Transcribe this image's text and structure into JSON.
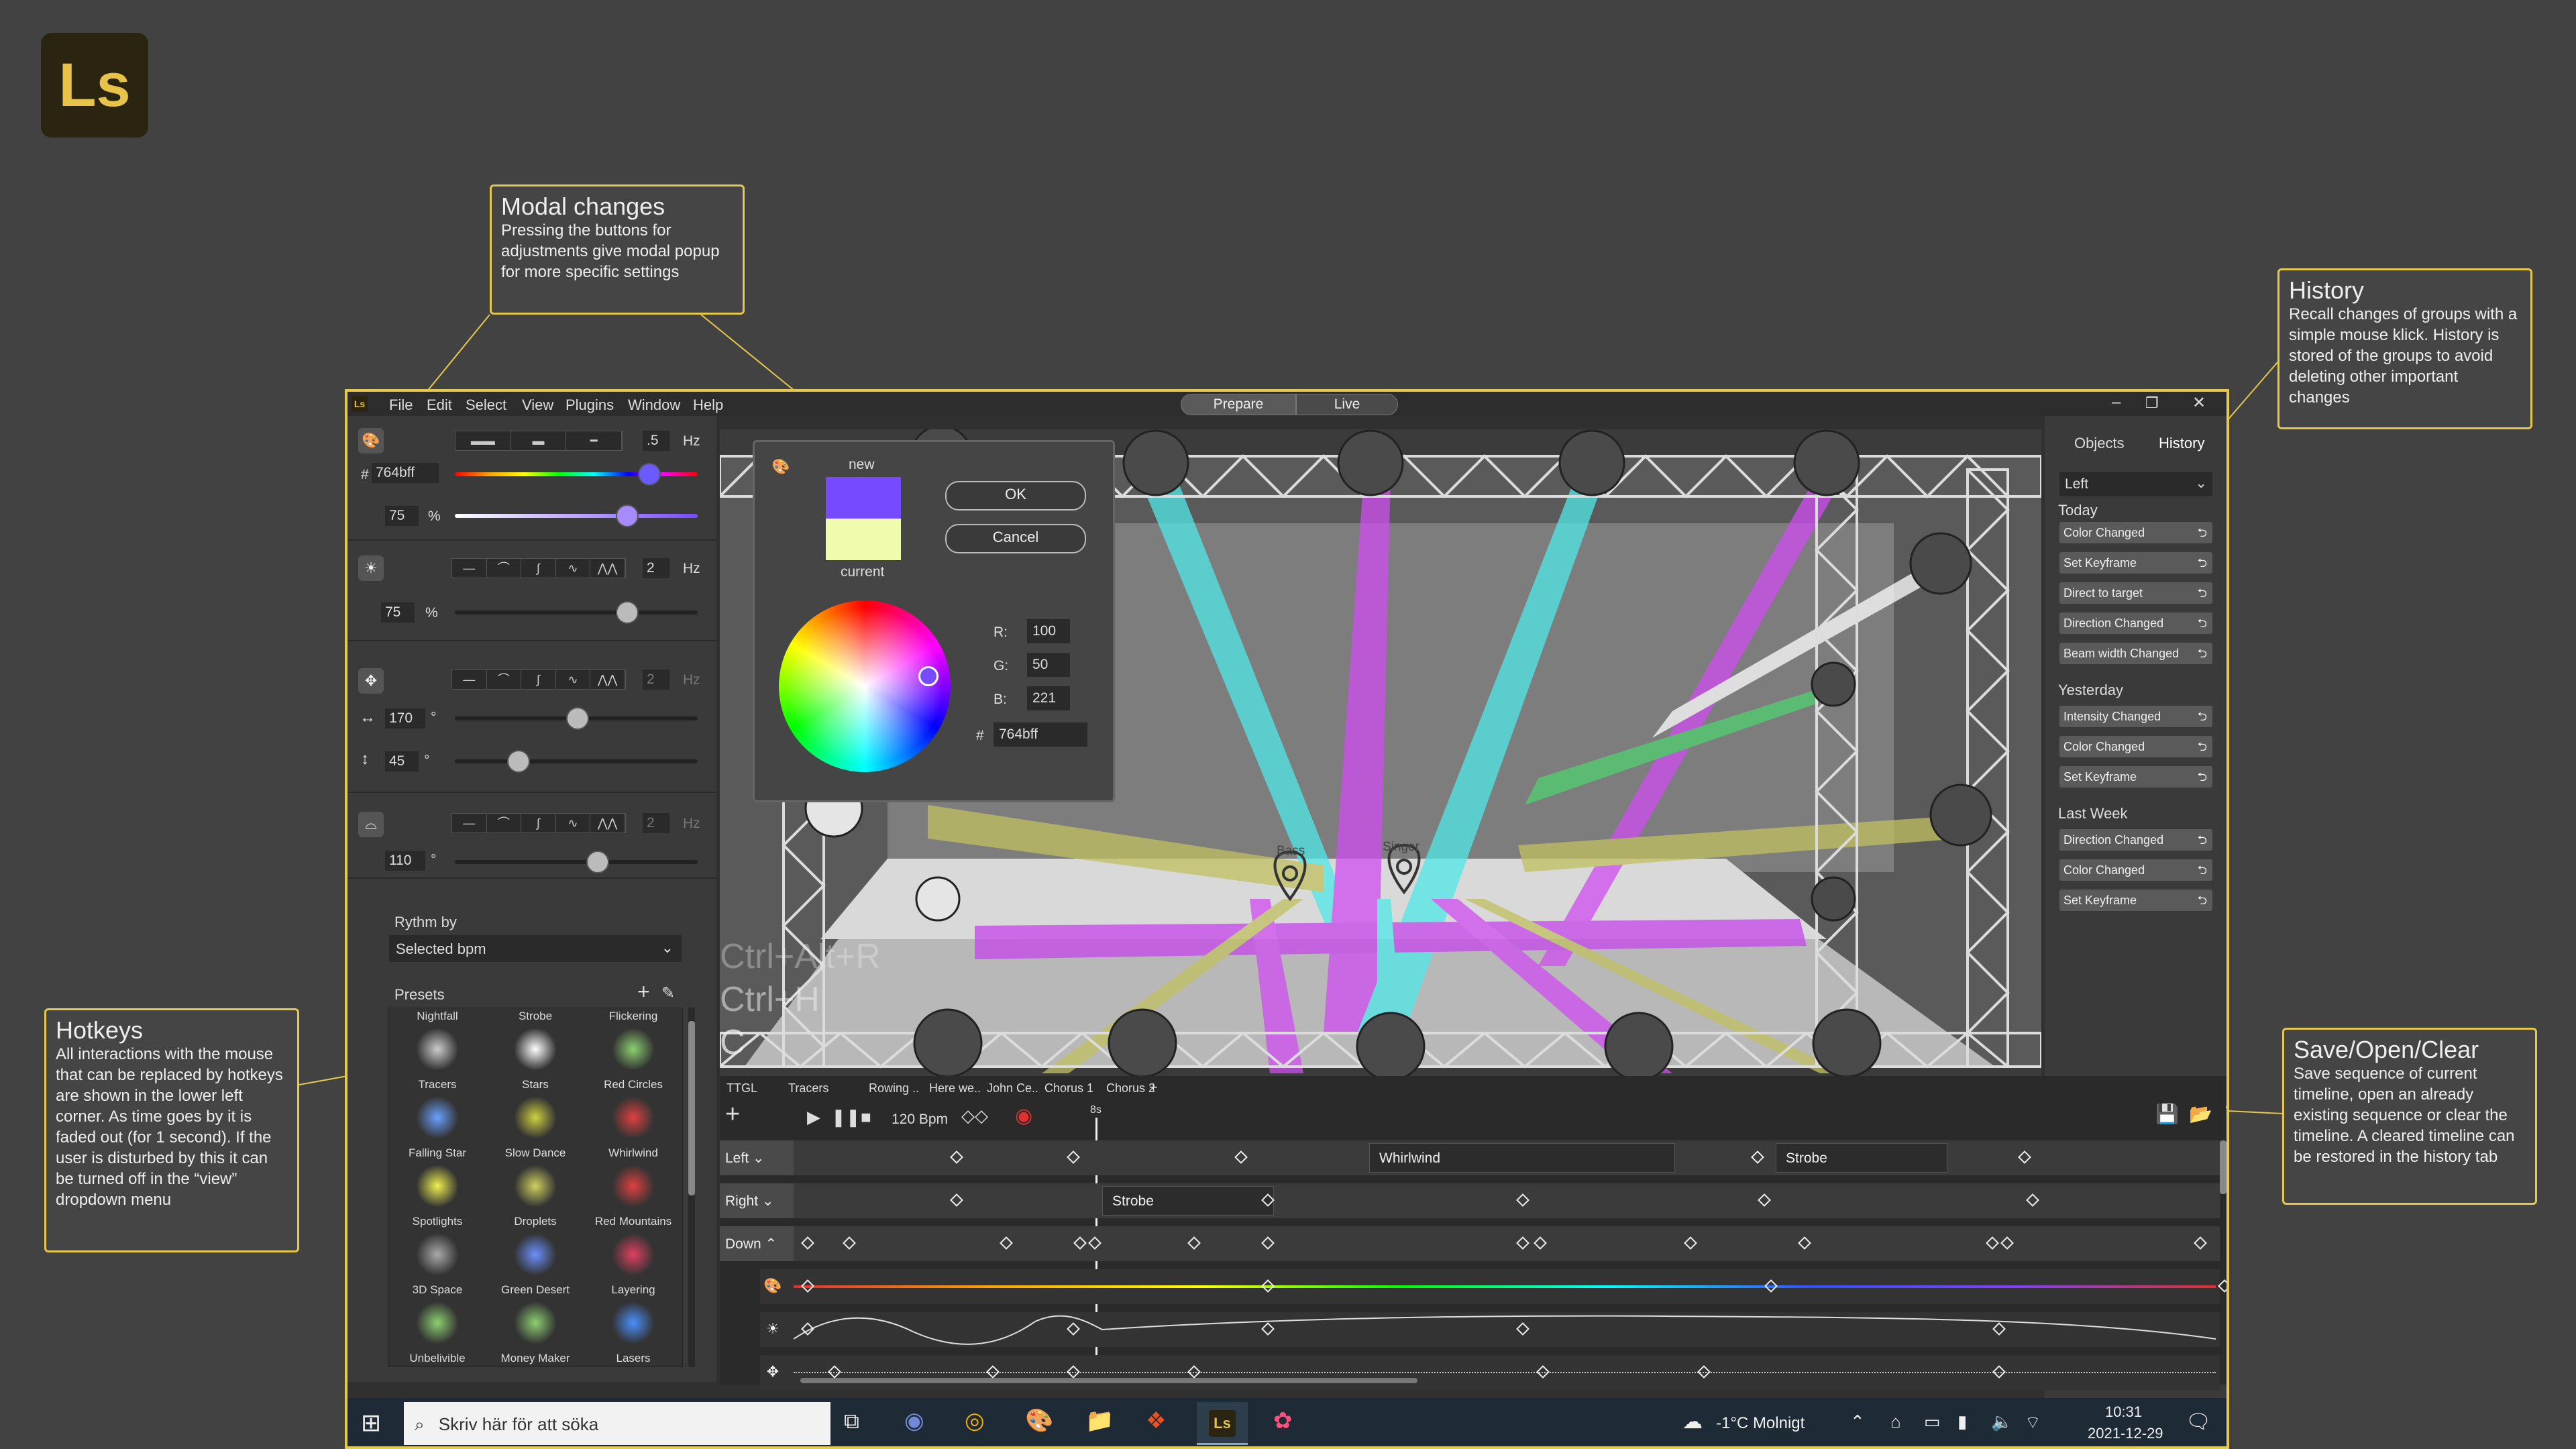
{
  "logo": {
    "text": "Ls"
  },
  "callouts": {
    "modal": {
      "title": "Modal changes",
      "body": "Pressing the buttons for adjustments give modal popup for more specific settings"
    },
    "history": {
      "title": "History",
      "body": "Recall changes of groups with a simple mouse klick. History is stored of the groups to avoid deleting other important changes"
    },
    "hotkeys": {
      "title": "Hotkeys",
      "body": "All interactions with the mouse that can be replaced by hotkeys are shown in the lower left corner. As time goes by it is faded out (for 1 second). If the user is disturbed by this it can be turned off in the “view” dropdown menu"
    },
    "save": {
      "title": "Save/Open/Clear",
      "body": "Save sequence of current timeline, open an already existing sequence or clear the timeline. A cleared timeline can be restored in the history tab"
    }
  },
  "menu": [
    "File",
    "Edit",
    "Select",
    "View",
    "Plugins",
    "Window",
    "Help"
  ],
  "modes": {
    "prepare": "Prepare",
    "live": "Live"
  },
  "left": {
    "color": {
      "freq": ".5",
      "hz": "Hz",
      "hex": "764bff",
      "hash": "#",
      "pct": "75",
      "pctunit": "%"
    },
    "intensity": {
      "freq": "2",
      "hz": "Hz",
      "pct": "75",
      "pctunit": "%"
    },
    "movement": {
      "freq": "2",
      "hz": "Hz",
      "pan": "170",
      "tilt": "45",
      "deg": "°"
    },
    "beam": {
      "freq": "2",
      "hz": "Hz",
      "angle": "110",
      "deg": "°"
    },
    "rhythm": {
      "label": "Rythm by",
      "value": "Selected bpm"
    },
    "presets": {
      "label": "Presets",
      "items": [
        "Nightfall",
        "Strobe",
        "Flickering",
        "Tracers",
        "Stars",
        "Red Circles",
        "Falling Star",
        "Slow Dance",
        "Whirlwind",
        "Spotlights",
        "Droplets",
        "Red Mountains",
        "3D Space",
        "Green Desert",
        "Layering",
        "Unbelivible",
        "Money Maker",
        "Lasers"
      ]
    }
  },
  "stage": {
    "bass": "Bass",
    "singer": "Singer",
    "hotkeys": [
      "Ctrl+Alt+R",
      "Ctrl+H",
      "C"
    ]
  },
  "colorpopup": {
    "new": "new",
    "current": "current",
    "ok": "OK",
    "cancel": "Cancel",
    "r_label": "R:",
    "g_label": "G:",
    "b_label": "B:",
    "r": "100",
    "g": "50",
    "b": "221",
    "hash": "#",
    "hex": "764bff"
  },
  "right": {
    "tabs": [
      "Objects",
      "History"
    ],
    "group": "Left",
    "today": "Today",
    "today_items": [
      "Color Changed",
      "Set Keyframe",
      "Direct to target",
      "Direction Changed",
      "Beam width Changed"
    ],
    "yesterday": "Yesterday",
    "yesterday_items": [
      "Intensity Changed",
      "Color Changed",
      "Set Keyframe"
    ],
    "lastweek": "Last Week",
    "lastweek_items": [
      "Direction Changed",
      "Color Changed",
      "Set Keyframe"
    ]
  },
  "timeline": {
    "ttgl": "TTGL",
    "tabs": [
      "Tracers",
      "Rowing ..",
      "Here we..",
      "John Ce..",
      "Chorus 1",
      "Chorus 2"
    ],
    "plus": "+",
    "bpm": "120 Bpm",
    "marker": "8s",
    "tracks": [
      "Left",
      "Right",
      "Down"
    ],
    "clips": {
      "whirlwind": "Whirlwind",
      "strobe1": "Strobe",
      "strobe2": "Strobe"
    }
  },
  "taskbar": {
    "search": "Skriv här för att söka",
    "weather": "-1°C  Molnigt",
    "time": "10:31",
    "date": "2021-12-29"
  }
}
